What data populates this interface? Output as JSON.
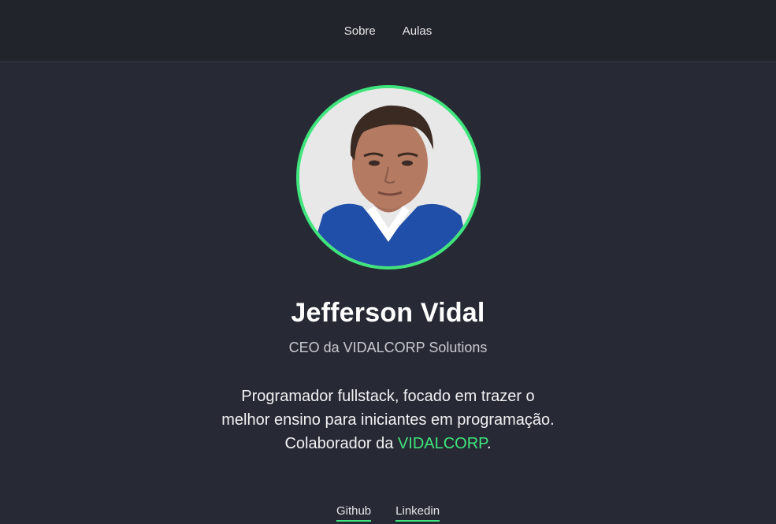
{
  "nav": {
    "items": [
      {
        "label": "Sobre"
      },
      {
        "label": "Aulas"
      }
    ]
  },
  "profile": {
    "name": "Jefferson Vidal",
    "role": "CEO da VIDALCORP Solutions",
    "bio_line1": "Programador fullstack, focado em trazer o",
    "bio_line2": "melhor ensino para iniciantes em programação.",
    "bio_line3_prefix": "Colaborador da ",
    "bio_line3_link": "VIDALCORP",
    "bio_line3_suffix": "."
  },
  "links": {
    "github": "Github",
    "linkedin": "Linkedin"
  },
  "colors": {
    "accent": "#3fe57c",
    "background": "#272a35",
    "nav_background": "#22242c"
  }
}
